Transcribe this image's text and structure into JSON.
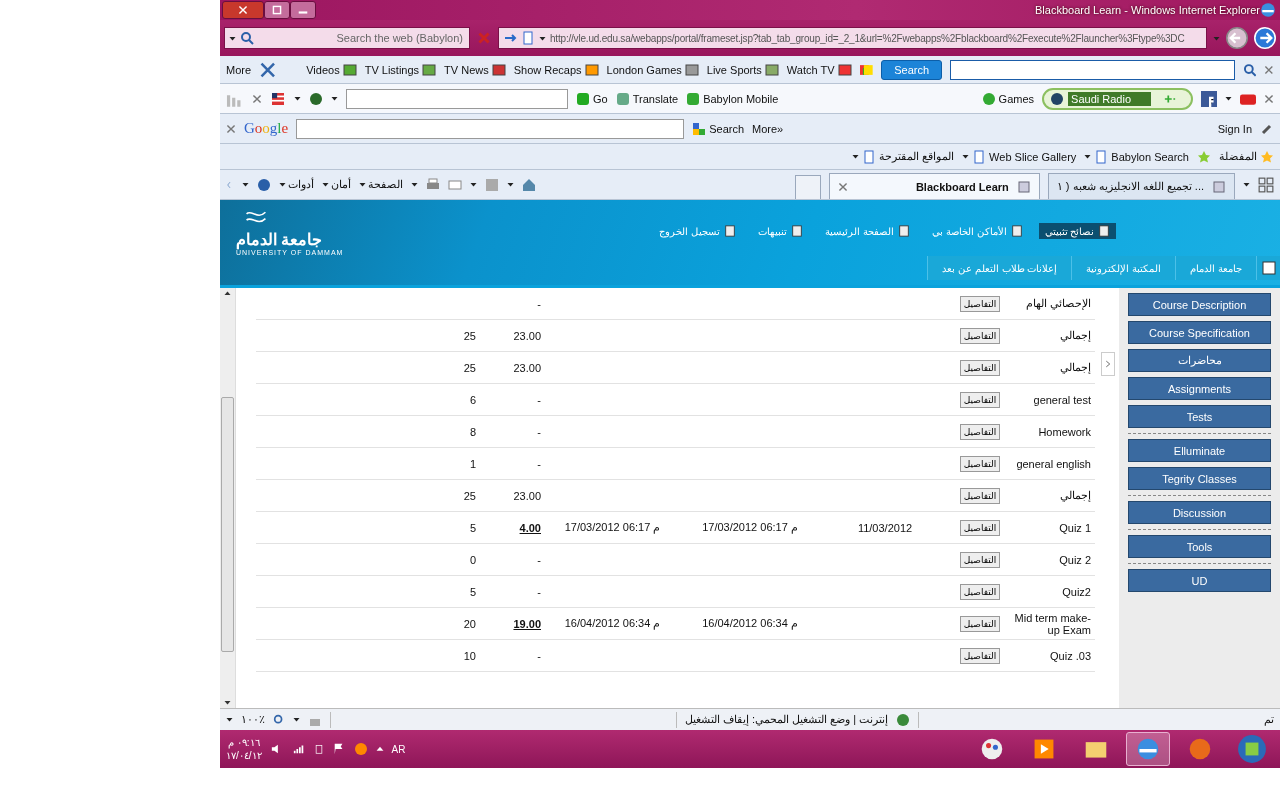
{
  "window": {
    "title": "Blackboard Learn - Windows Internet Explorer"
  },
  "search_box": {
    "placeholder": "Search the web (Babylon)"
  },
  "address_bar": {
    "url": "http://vle.ud.edu.sa/webapps/portal/frameset.jsp?tab_tab_group_id=_2_1&url=%2Fwebapps%2Fblackboard%2Fexecute%2Flauncher%3Ftype%3DC"
  },
  "media_toolbar": {
    "more": "More",
    "items": [
      "Watch TV",
      "Live Sports",
      "London Games",
      "Show Recaps",
      "TV News",
      "TV Listings",
      "Videos"
    ],
    "search_button": "Search"
  },
  "babylon_toolbar": {
    "buttons": [
      "Babylon Mobile",
      "Translate",
      "Go"
    ],
    "games": "Games",
    "radio": "Saudi Radio"
  },
  "google_toolbar": {
    "logo": "Google",
    "search": "Search",
    "more": "More»",
    "sign_in": "Sign In"
  },
  "favorites_bar": {
    "favorites": "المفضلة",
    "links": [
      "Babylon Search",
      "Web Slice Gallery",
      "المواقع المقترحة"
    ]
  },
  "tabs": [
    {
      "label": "تجميع اللغه الانجليزيه شعبه ( ١ ...",
      "selected": false
    },
    {
      "label": "Blackboard Learn",
      "selected": true
    }
  ],
  "command_bar": [
    "الصفحة",
    "أمان",
    "أدوات"
  ],
  "portal": {
    "university_ar": "جامعة الدمام",
    "university_en": "UNIVERSITY OF DAMMAM",
    "links": [
      {
        "label": "نصائح تثبيتي",
        "selected": true
      },
      {
        "label": "الأماكن الخاصة بي",
        "selected": false
      },
      {
        "label": "الصفحة الرئيسية",
        "selected": false
      },
      {
        "label": "تنبيهات",
        "selected": false
      },
      {
        "label": "تسجيل الخروج",
        "selected": false
      }
    ],
    "nav_tabs": [
      "جامعة الدمام",
      "المكتبة الإلكترونية",
      "إعلانات طلاب التعلم عن بعد"
    ]
  },
  "grades": {
    "rows": [
      {
        "name": "الإحصائي الهام",
        "button": "التفاصيل",
        "score": "-",
        "score_link": false
      },
      {
        "name": "إجمالي",
        "button": "التفاصيل",
        "score": "23.00",
        "score_link": false,
        "points": "25"
      },
      {
        "name": "إجمالي",
        "button": "التفاصيل",
        "score": "23.00",
        "score_link": false,
        "points": "25"
      },
      {
        "name": "general test",
        "button": "التفاصيل",
        "score": "-",
        "score_link": false,
        "points": "6"
      },
      {
        "name": "Homework",
        "button": "التفاصيل",
        "score": "-",
        "score_link": false,
        "points": "8"
      },
      {
        "name": "general english",
        "button": "التفاصيل",
        "score": "-",
        "score_link": false,
        "points": "1"
      },
      {
        "name": "إجمالي",
        "button": "التفاصيل",
        "score": "23.00",
        "score_link": false,
        "points": "25"
      },
      {
        "name": "Quiz 1",
        "button": "التفاصيل",
        "column_3": "11/03/2012",
        "column_4": "م 06:17 17/03/2012",
        "column_5": "م 06:17 17/03/2012",
        "score": "4.00",
        "score_link": true,
        "points": "5"
      },
      {
        "name": "Quiz 2",
        "button": "التفاصيل",
        "score": "-",
        "score_link": false,
        "points": "0"
      },
      {
        "name": "Quiz2",
        "button": "التفاصيل",
        "score": "-",
        "score_link": false,
        "points": "5"
      },
      {
        "name": "Mid term make-up Exam",
        "button": "التفاصيل",
        "column_4": "م 06:34 16/04/2012",
        "column_5": "م 06:34 16/04/2012",
        "score": "19.00",
        "score_link": true,
        "points": "20"
      },
      {
        "name": "Quiz .03",
        "button": "التفاصيل",
        "score": "-",
        "score_link": false,
        "points": "10"
      }
    ]
  },
  "course_menu": {
    "groups": [
      [
        "Course Description",
        "Course Specification",
        "محاضرات",
        "Assignments",
        "Tests"
      ],
      [
        "Elluminate",
        "Tegrity Classes"
      ],
      [
        "Discussion"
      ],
      [
        "Tools"
      ],
      [
        "UD"
      ]
    ]
  },
  "status_bar": {
    "zoom": "١٠٠٪",
    "zone": "إنترنت | وضع التشغيل المحمي: إيقاف التشغيل",
    "status": "تم"
  },
  "taskbar": {
    "time": "٠٩:١٦ م",
    "date": "١٧/٠٤/١٢",
    "language": "AR"
  }
}
